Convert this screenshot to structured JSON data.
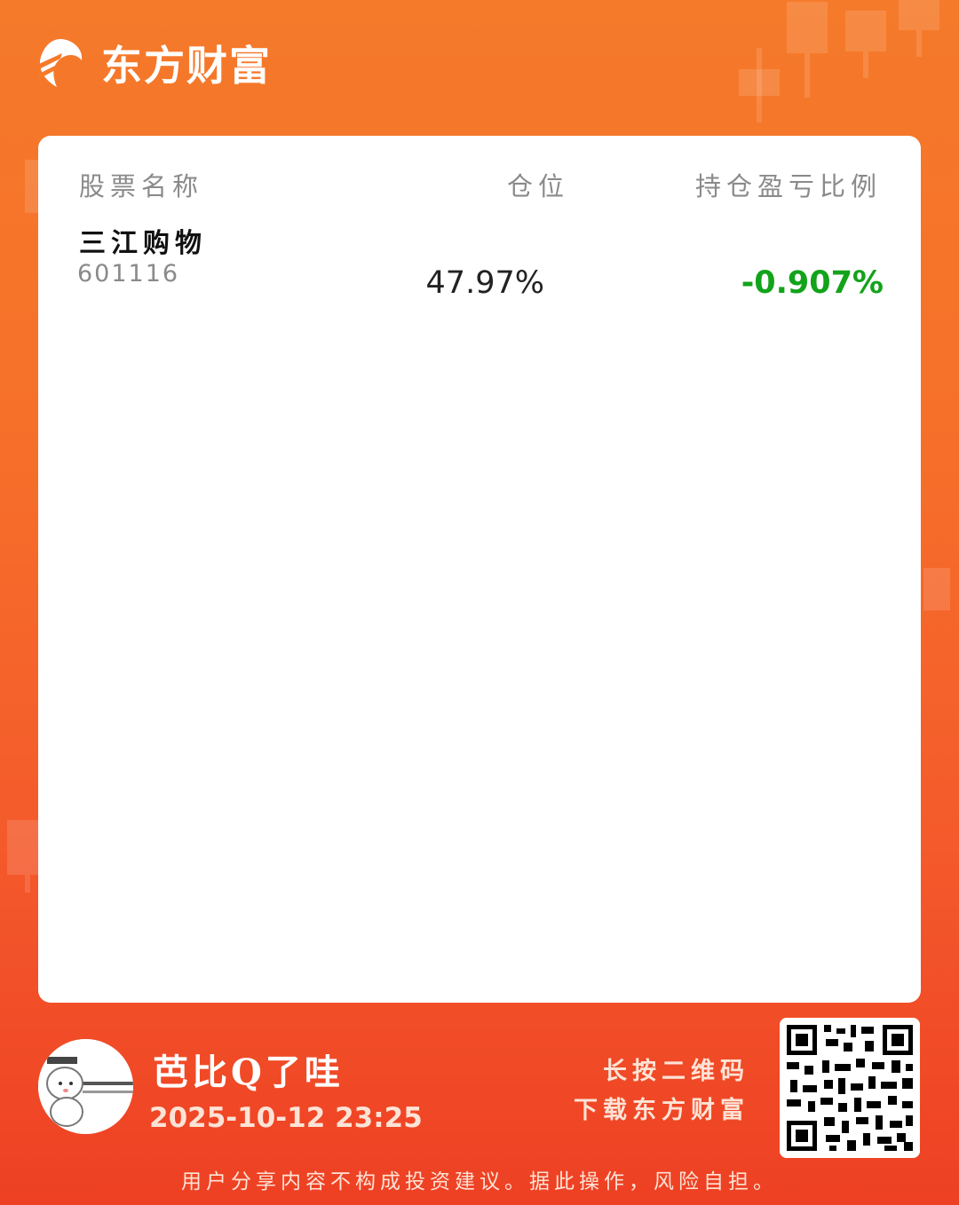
{
  "brand": {
    "name": "东方财富",
    "logo_icon": "eastmoney-logo-icon"
  },
  "table": {
    "headers": {
      "name": "股票名称",
      "position": "仓位",
      "profit_loss": "持仓盈亏比例"
    },
    "rows": [
      {
        "name": "三江购物",
        "code": "601116",
        "position": "47.97%",
        "profit_loss": "-0.907%"
      }
    ]
  },
  "footer": {
    "user_name": "芭比Q了哇",
    "timestamp": "2025-10-12 23:25",
    "qr_hint_line1": "长按二维码",
    "qr_hint_line2": "下载东方财富",
    "disclaimer": "用户分享内容不构成投资建议。据此操作，风险自担。"
  },
  "colors": {
    "accent": "#f57a2a",
    "loss": "#12a31a",
    "card": "#ffffff"
  }
}
